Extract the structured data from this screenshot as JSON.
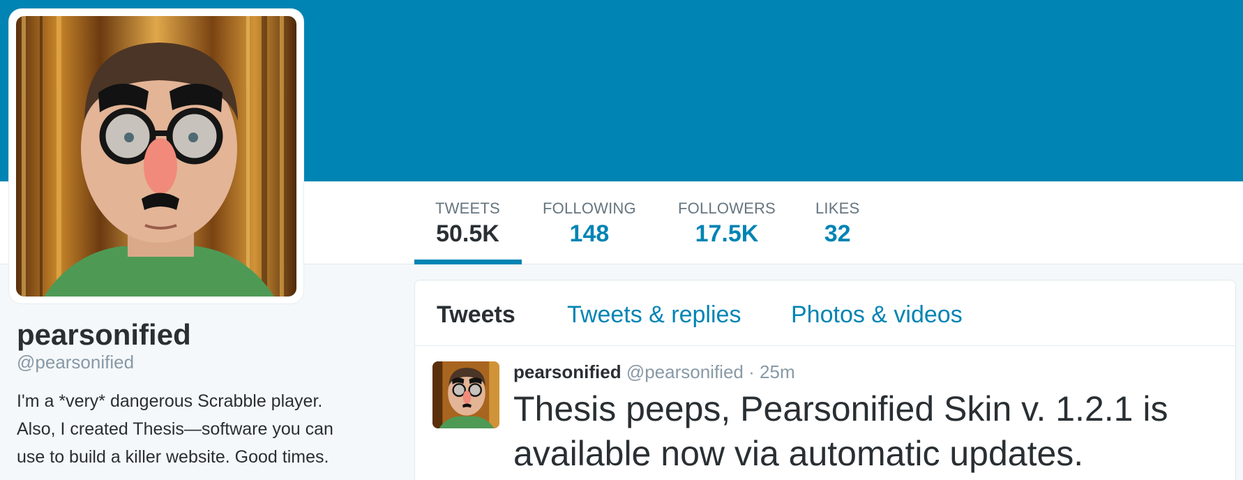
{
  "profile": {
    "name": "pearsonified",
    "handle": "@pearsonified",
    "bio_lines": [
      "I'm a *very* dangerous Scrabble player.",
      "Also, I created Thesis—software you can",
      "use to build a killer website. Good times."
    ]
  },
  "stats": [
    {
      "label": "TWEETS",
      "value": "50.5K",
      "active": true
    },
    {
      "label": "FOLLOWING",
      "value": "148",
      "active": false
    },
    {
      "label": "FOLLOWERS",
      "value": "17.5K",
      "active": false
    },
    {
      "label": "LIKES",
      "value": "32",
      "active": false
    }
  ],
  "tabs": [
    {
      "label": "Tweets",
      "active": true
    },
    {
      "label": "Tweets & replies",
      "active": false
    },
    {
      "label": "Photos & videos",
      "active": false
    }
  ],
  "tweet": {
    "name": "pearsonified",
    "handle": "@pearsonified",
    "separator": "·",
    "time": "25m",
    "text_lines": [
      "Thesis peeps, Pearsonified Skin v. 1.2.1 is",
      "available now via automatic updates."
    ]
  },
  "colors": {
    "banner": "#0084b4",
    "link": "#0084b4",
    "text": "#292f33",
    "muted": "#8899a6",
    "background": "#f5f8fa"
  }
}
